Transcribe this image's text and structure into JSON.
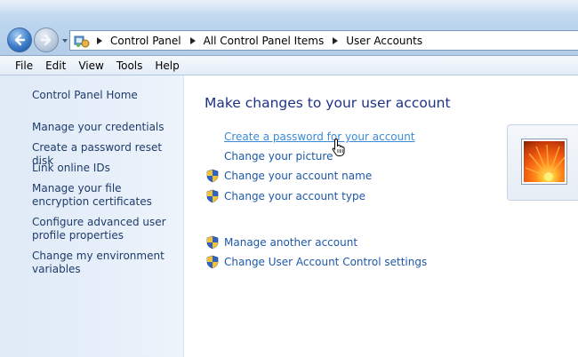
{
  "address_bar": {
    "icon": "control-panel-icon",
    "crumbs": [
      "Control Panel",
      "All Control Panel Items",
      "User Accounts"
    ]
  },
  "menu": [
    "File",
    "Edit",
    "View",
    "Tools",
    "Help"
  ],
  "sidebar": {
    "home": "Control Panel Home",
    "links": [
      "Manage your credentials",
      "Create a password reset disk",
      "Link online IDs",
      "Manage your file encryption certificates",
      "Configure advanced user profile properties",
      "Change my environment variables"
    ]
  },
  "main": {
    "heading": "Make changes to your user account",
    "tasks": [
      {
        "label": "Create a password for your account",
        "shield": false
      },
      {
        "label": "Change your picture",
        "shield": false
      },
      {
        "label": "Change your account name",
        "shield": true
      },
      {
        "label": "Change your account type",
        "shield": true
      }
    ],
    "other_tasks": [
      {
        "label": "Manage another account",
        "shield": true
      },
      {
        "label": "Change User Account Control settings",
        "shield": true
      }
    ]
  },
  "colors": {
    "link": "#1f58a8",
    "hover_link": "#3c8ad6",
    "heading": "#1e3287",
    "sidebar_bg": "#dfeaf7"
  }
}
